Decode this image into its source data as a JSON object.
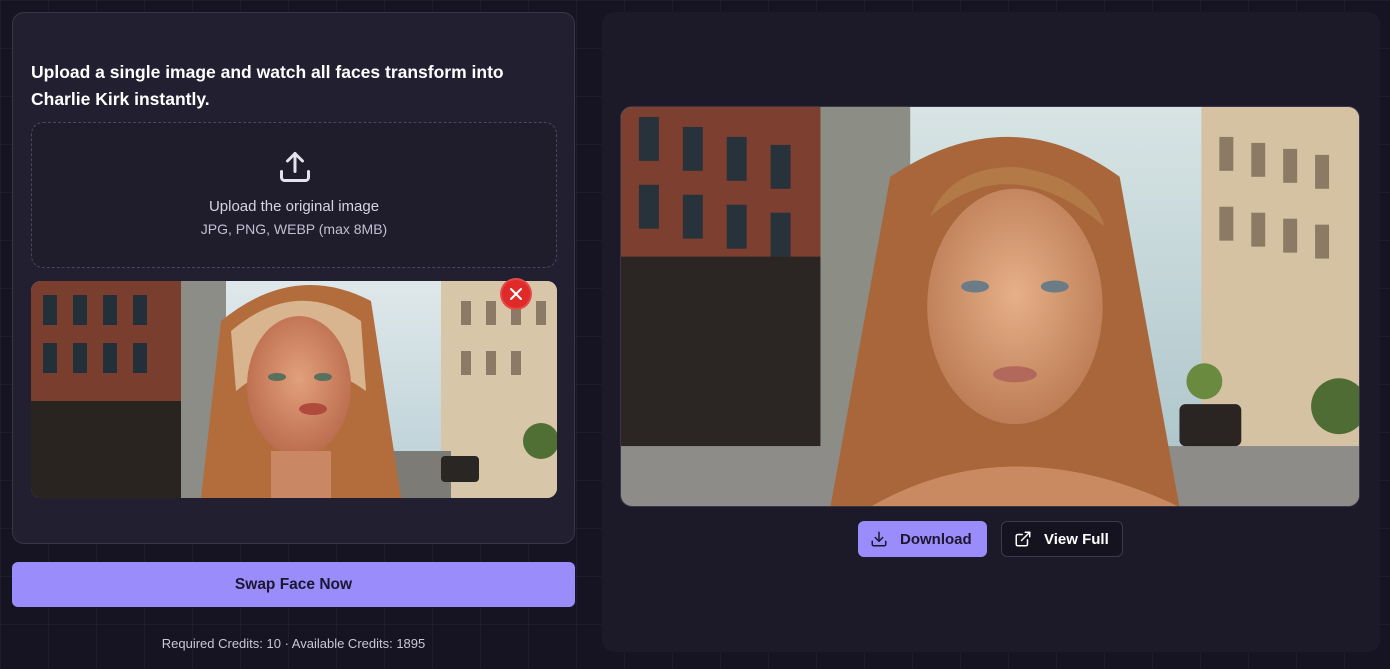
{
  "upload_panel": {
    "headline": "Upload a single image and watch all faces transform into Charlie Kirk instantly.",
    "dropzone": {
      "icon": "upload-icon",
      "title": "Upload the original image",
      "formats": "JPG, PNG, WEBP (max 8MB)"
    },
    "preview": {
      "remove_icon": "close-icon"
    }
  },
  "actions": {
    "swap_label": "Swap Face Now",
    "credits_text": "Required Credits: 10 · Available Credits: 1895"
  },
  "result_panel": {
    "download_label": "Download",
    "download_icon": "download-icon",
    "view_full_label": "View Full",
    "view_full_icon": "external-link-icon"
  },
  "theme": {
    "accent": "#9a8cfb",
    "danger": "#e02a2a",
    "background": "#161422",
    "card": "#221f30"
  }
}
